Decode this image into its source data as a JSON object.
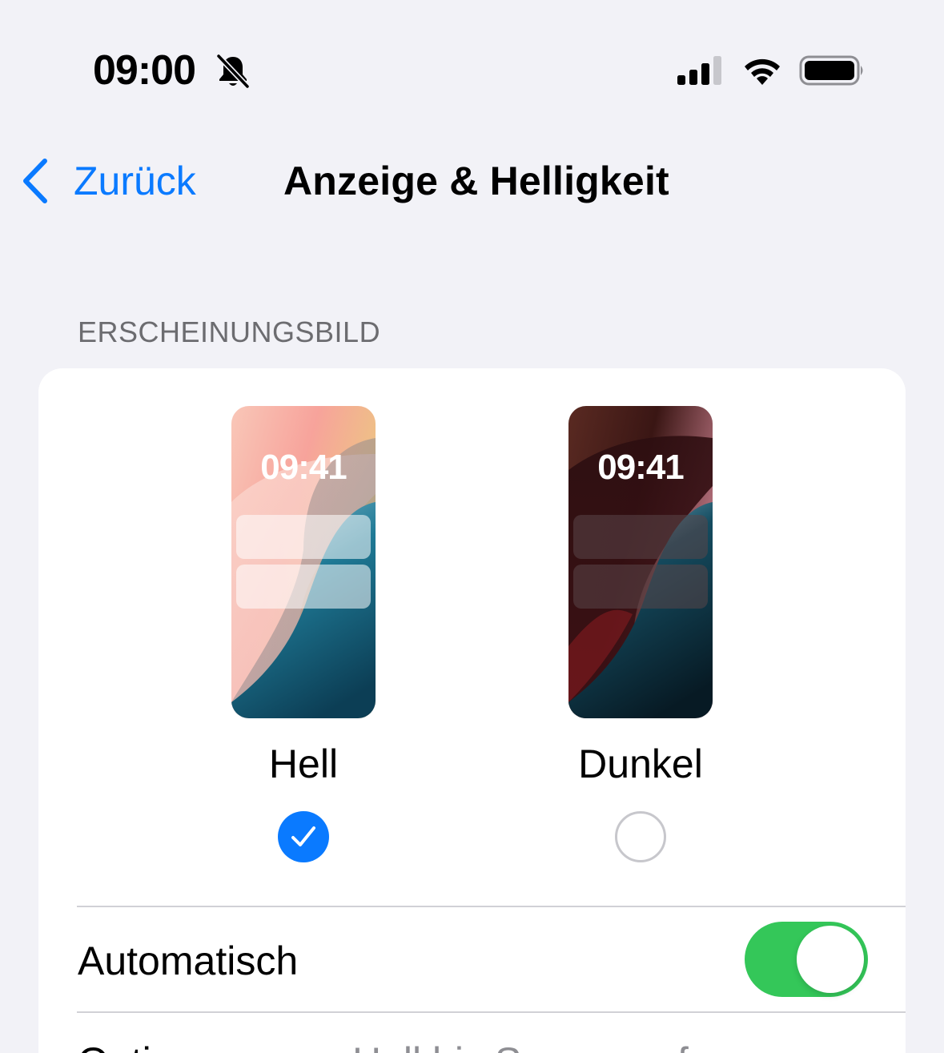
{
  "status_bar": {
    "time": "09:00",
    "bell_icon": "bell-slash-icon",
    "signal_icon": "cellular-signal-icon",
    "wifi_icon": "wifi-icon",
    "battery_icon": "battery-icon"
  },
  "nav": {
    "back_label": "Zurück",
    "title": "Anzeige & Helligkeit",
    "accent_color": "#0A7AFF"
  },
  "appearance": {
    "section_header": "ERSCHEINUNGSBILD",
    "options": [
      {
        "label": "Hell",
        "preview_time": "09:41",
        "selected": true
      },
      {
        "label": "Dunkel",
        "preview_time": "09:41",
        "selected": false
      }
    ],
    "automatic_label": "Automatisch",
    "automatic_on": true,
    "toggle_color": "#34C759",
    "options_row_label": "Optionen",
    "options_row_value": "Hell bis Sonnenaufgang"
  }
}
